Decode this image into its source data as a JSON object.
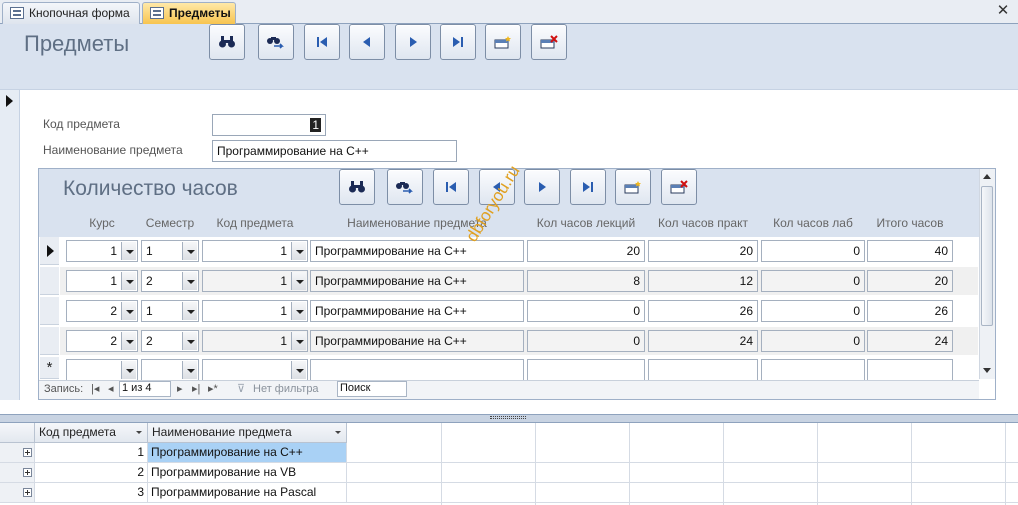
{
  "tabs": [
    {
      "label": "Кнопочная форма",
      "icon": "form-icon"
    },
    {
      "label": "Предметы",
      "icon": "form-icon",
      "active": true
    }
  ],
  "form": {
    "title": "Предметы",
    "fields": {
      "code_label": "Код предмета",
      "code_value": "1",
      "name_label": "Наименование предмета",
      "name_value": "Программирование на С++"
    }
  },
  "toolbar_icons": [
    "find-icon",
    "find-next-icon",
    "first-record-icon",
    "previous-record-icon",
    "next-record-icon",
    "last-record-icon",
    "new-record-icon",
    "delete-record-icon"
  ],
  "subform": {
    "title": "Количество часов",
    "columns": [
      "Курс",
      "Семестр",
      "Код предмета",
      "Наименование предмета",
      "Кол часов лекций",
      "Кол часов практ",
      "Кол часов лаб",
      "Итого часов"
    ],
    "rows": [
      {
        "kurs": "1",
        "semestr": "1",
        "kod": "1",
        "name": "Программирование на С++",
        "lek": "20",
        "prakt": "20",
        "lab": "0",
        "itogo": "40"
      },
      {
        "kurs": "1",
        "semestr": "2",
        "kod": "1",
        "name": "Программирование на С++",
        "lek": "8",
        "prakt": "12",
        "lab": "0",
        "itogo": "20"
      },
      {
        "kurs": "2",
        "semestr": "1",
        "kod": "1",
        "name": "Программирование на С++",
        "lek": "0",
        "prakt": "26",
        "lab": "0",
        "itogo": "26"
      },
      {
        "kurs": "2",
        "semestr": "2",
        "kod": "1",
        "name": "Программирование на С++",
        "lek": "0",
        "prakt": "24",
        "lab": "0",
        "itogo": "24"
      }
    ],
    "new_row_marker": "*",
    "navigation": {
      "record_label": "Запись:",
      "position": "1 из 4",
      "filter": "Нет фильтра",
      "search": "Поиск"
    }
  },
  "datasheet": {
    "columns": [
      "Код предмета",
      "Наименование предмета"
    ],
    "rows": [
      {
        "kod": "1",
        "name": "Программирование на С++"
      },
      {
        "kod": "2",
        "name": "Программирование на VB"
      },
      {
        "kod": "3",
        "name": "Программирование на Pascal"
      }
    ]
  },
  "watermark": "dbforyou.ru",
  "colors": {
    "active_tab": "#f7c450",
    "header_bg": "#d9e2ef",
    "selected_cell": "#a9d1f5",
    "title_text": "#5f6f84"
  }
}
